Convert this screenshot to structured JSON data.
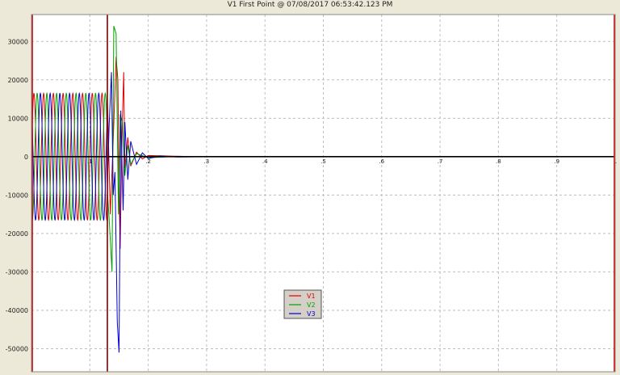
{
  "window": {
    "title": "V1 First Point @ 07/08/2017 06:53:42.123 PM"
  },
  "chart_data": {
    "type": "line",
    "title": "V1 First Point @ 07/08/2017 06:53:42.123 PM",
    "xlabel": "",
    "ylabel": "",
    "xlim": [
      0,
      1
    ],
    "ylim": [
      -56000,
      37000
    ],
    "x_ticks": [
      0.1,
      0.2,
      0.3,
      0.4,
      0.5,
      0.6,
      0.7,
      0.8,
      0.9,
      1
    ],
    "x_tick_labels": [
      ".1",
      ".2",
      ".3",
      ".4",
      ".5",
      ".6",
      ".7",
      ".8",
      ".9",
      "1"
    ],
    "y_ticks": [
      30000,
      20000,
      10000,
      0,
      -10000,
      -20000,
      -30000,
      -40000,
      -50000
    ],
    "y_tick_labels": [
      "30000",
      "20000",
      "10000",
      "0",
      "-10000",
      "-20000",
      "-30000",
      "-40000",
      "-50000"
    ],
    "grid": true,
    "cursors": [
      {
        "name": "left-cursor",
        "x": 0.0,
        "color": "#cc0000"
      },
      {
        "name": "dark-cursor",
        "x": 0.13,
        "color": "#7a0000"
      },
      {
        "name": "right-cursor",
        "x": 1.0,
        "color": "#dd0000"
      }
    ],
    "steady_state": {
      "amplitude": 16500,
      "frequency_hz": 60,
      "fault_start": 0.13,
      "fault_end": 0.165
    },
    "legend_position": "lower-center",
    "series": [
      {
        "name": "V1",
        "color": "#e00000",
        "phase_deg": 0,
        "transient": [
          [
            0.13,
            16000
          ],
          [
            0.135,
            -15000
          ],
          [
            0.14,
            4000
          ],
          [
            0.145,
            26000
          ],
          [
            0.148,
            20000
          ],
          [
            0.15,
            -9000
          ],
          [
            0.152,
            -24000
          ],
          [
            0.155,
            5000
          ],
          [
            0.158,
            22000
          ],
          [
            0.16,
            -3000
          ],
          [
            0.165,
            5000
          ],
          [
            0.17,
            -2500
          ],
          [
            0.18,
            1200
          ],
          [
            0.19,
            -600
          ],
          [
            0.2,
            300
          ],
          [
            0.25,
            100
          ],
          [
            0.3,
            0
          ]
        ]
      },
      {
        "name": "V2",
        "color": "#00a000",
        "phase_deg": -120,
        "transient": [
          [
            0.13,
            -9000
          ],
          [
            0.133,
            -16000
          ],
          [
            0.138,
            -30000
          ],
          [
            0.141,
            34000
          ],
          [
            0.145,
            32000
          ],
          [
            0.149,
            -15000
          ],
          [
            0.152,
            11000
          ],
          [
            0.156,
            9000
          ],
          [
            0.16,
            -5000
          ],
          [
            0.165,
            3000
          ],
          [
            0.17,
            -2000
          ],
          [
            0.18,
            800
          ],
          [
            0.2,
            -300
          ],
          [
            0.25,
            100
          ],
          [
            0.3,
            0
          ]
        ]
      },
      {
        "name": "V3",
        "color": "#0000d0",
        "phase_deg": 120,
        "transient": [
          [
            0.13,
            -8000
          ],
          [
            0.133,
            8000
          ],
          [
            0.137,
            22000
          ],
          [
            0.14,
            -10000
          ],
          [
            0.143,
            -4000
          ],
          [
            0.147,
            -43000
          ],
          [
            0.15,
            -51000
          ],
          [
            0.153,
            12000
          ],
          [
            0.157,
            -14000
          ],
          [
            0.16,
            9000
          ],
          [
            0.165,
            -6000
          ],
          [
            0.17,
            4000
          ],
          [
            0.18,
            -2000
          ],
          [
            0.19,
            1000
          ],
          [
            0.2,
            -500
          ],
          [
            0.22,
            200
          ],
          [
            0.25,
            -80
          ],
          [
            0.3,
            0
          ]
        ]
      }
    ]
  }
}
